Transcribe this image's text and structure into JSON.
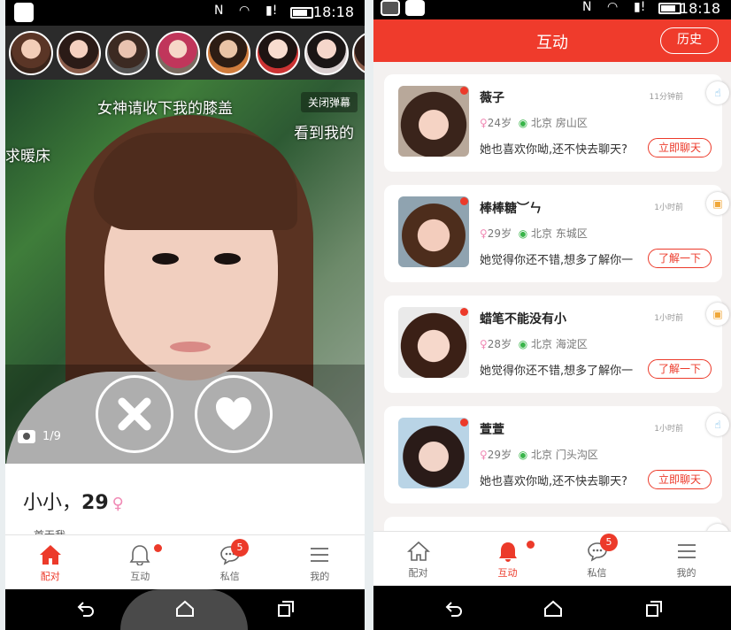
{
  "status": {
    "time_left": "18:18",
    "time_right": "18:18"
  },
  "left": {
    "danmu": [
      "女神请收下我的膝盖",
      "求暖床",
      "看到我的"
    ],
    "close_danmu": "关闭弹幕",
    "photo_counter": "1/9",
    "profile_name": "小小，",
    "profile_age": "29",
    "profile_sub": "一首无我",
    "nav": [
      {
        "label": "配对",
        "icon": "home-icon",
        "active": true
      },
      {
        "label": "互动",
        "icon": "bell-icon"
      },
      {
        "label": "私信",
        "icon": "chat-icon",
        "badge": "5"
      },
      {
        "label": "我的",
        "icon": "menu-icon"
      }
    ]
  },
  "right": {
    "title": "互动",
    "history_button": "历史",
    "cards": [
      {
        "name": "薇子",
        "time": "11分钟前",
        "age": "24岁",
        "location": "北京 房山区",
        "message": "她也喜欢你呦,还不快去聊天?",
        "button": "立即聊天"
      },
      {
        "name": "棒棒糖︶ㄣ",
        "time": "1小时前",
        "age": "29岁",
        "location": "北京 东城区",
        "message": "她觉得你还不错,想多了解你一",
        "button": "了解一下"
      },
      {
        "name": "蜡笔不能没有小",
        "time": "1小时前",
        "age": "28岁",
        "location": "北京 海淀区",
        "message": "她觉得你还不错,想多了解你一",
        "button": "了解一下"
      },
      {
        "name": "萱萱",
        "time": "1小时前",
        "age": "29岁",
        "location": "北京 门头沟区",
        "message": "她也喜欢你呦,还不快去聊天?",
        "button": "立即聊天"
      }
    ],
    "nav": [
      {
        "label": "配对",
        "icon": "home-icon"
      },
      {
        "label": "互动",
        "icon": "bell-icon",
        "active": true
      },
      {
        "label": "私信",
        "icon": "chat-icon",
        "badge": "5"
      },
      {
        "label": "我的",
        "icon": "menu-icon"
      }
    ]
  },
  "colors": {
    "accent": "#ec3a2a",
    "pink": "#f089b4",
    "green": "#39b54a"
  }
}
